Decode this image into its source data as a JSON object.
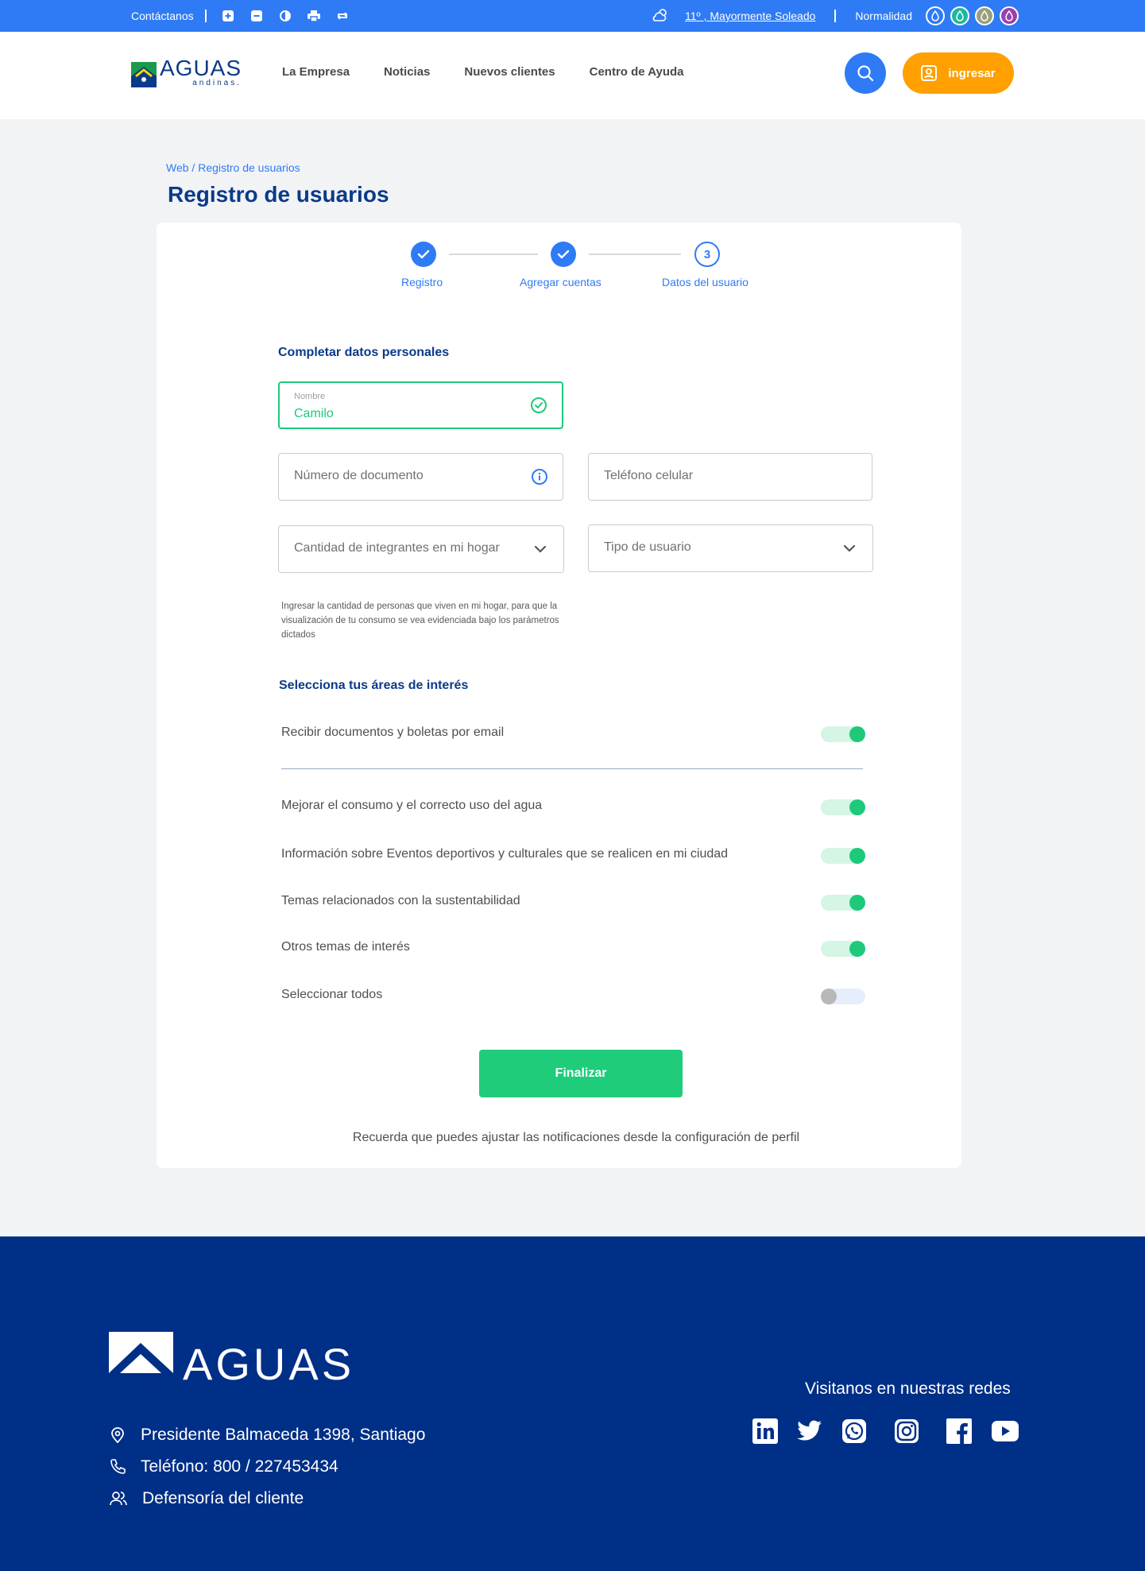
{
  "topbar": {
    "contact": "Contáctanos",
    "weather": "11º , Mayormente Soleado",
    "status": "Normalidad",
    "drop_colors": [
      "#2f7bf5",
      "#1ab8a0",
      "#9aa07a",
      "#9b3fb0"
    ]
  },
  "header": {
    "logo_big": "AGUAS",
    "logo_small": "andinas.",
    "nav": [
      "La Empresa",
      "Noticias",
      "Nuevos clientes",
      "Centro de Ayuda"
    ],
    "login": "ingresar"
  },
  "breadcrumb": "Web / Registro de usuarios",
  "page_title": "Registro de usuarios",
  "stepper": {
    "steps": [
      {
        "label": "Registro",
        "state": "done"
      },
      {
        "label": "Agregar cuentas",
        "state": "done"
      },
      {
        "label": "Datos del usuario",
        "state": "current",
        "number": "3"
      }
    ]
  },
  "form": {
    "section_title": "Completar datos personales",
    "nombre_label": "Nombre",
    "nombre_value": "Camilo",
    "documento_placeholder": "Número de documento",
    "telefono_placeholder": "Teléfono celular",
    "integrantes_placeholder": "Cantidad de integrantes en mi hogar",
    "tipo_placeholder": "Tipo de usuario",
    "helper": "Ingresar la cantidad de personas que viven en mi hogar, para que la visualización de tu consumo se vea evidenciada bajo los parámetros dictados"
  },
  "interests": {
    "title": "Selecciona tus áreas de interés",
    "items": [
      {
        "label": "Recibir documentos y boletas por email",
        "on": true
      },
      {
        "label": "Mejorar el consumo y el correcto uso del agua",
        "on": true
      },
      {
        "label": "Información sobre Eventos deportivos y culturales que se realicen en mi ciudad",
        "on": true
      },
      {
        "label": "Temas relacionados con la sustentabilidad",
        "on": true
      },
      {
        "label": "Otros temas de interés",
        "on": true
      },
      {
        "label": "Seleccionar todos",
        "on": false
      }
    ]
  },
  "finish_label": "Finalizar",
  "note": "Recuerda que puedes ajustar las notificaciones desde la configuración de perfil",
  "footer": {
    "logo": "AGUAS",
    "address": "Presidente Balmaceda 1398, Santiago",
    "phone": "Teléfono: 800 / 227453434",
    "defensoria": "Defensoría del cliente",
    "social_title": "Visitanos en nuestras redes",
    "social": [
      "linkedin-icon",
      "twitter-icon",
      "whatsapp-icon",
      "instagram-icon",
      "facebook-icon",
      "youtube-icon"
    ]
  }
}
